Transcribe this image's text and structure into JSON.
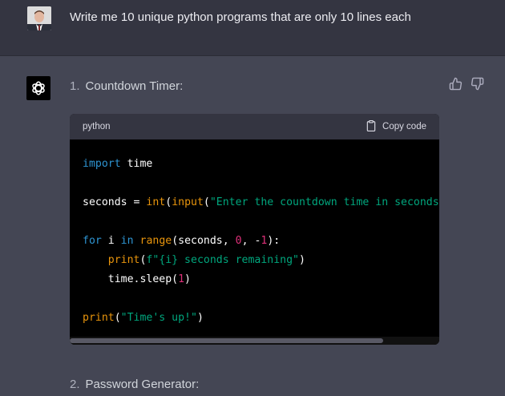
{
  "user_message": {
    "text": "Write me 10 unique python programs that are only 10 lines each"
  },
  "assistant": {
    "items": [
      {
        "number": "1.",
        "title": "Countdown Timer:"
      },
      {
        "number": "2.",
        "title": "Password Generator:"
      }
    ],
    "code_block": {
      "language": "python",
      "copy_label": "Copy code",
      "lines": [
        "import time",
        "",
        "seconds = int(input(\"Enter the countdown time in seconds: \"))",
        "",
        "for i in range(seconds, 0, -1):",
        "    print(f\"{i} seconds remaining\")",
        "    time.sleep(1)",
        "",
        "print(\"Time's up!\")"
      ]
    }
  },
  "icons": {
    "avatar": "user-avatar",
    "logo": "openai-logo-icon",
    "thumbs_up": "thumbs-up-icon",
    "thumbs_down": "thumbs-down-icon",
    "copy": "clipboard-icon"
  },
  "colors": {
    "user_bg": "#343541",
    "assistant_bg": "#444654",
    "code_bg": "#000000",
    "keyword": "#2e95d3",
    "builtin": "#e9950c",
    "string": "#00a67d",
    "number": "#df3079"
  }
}
